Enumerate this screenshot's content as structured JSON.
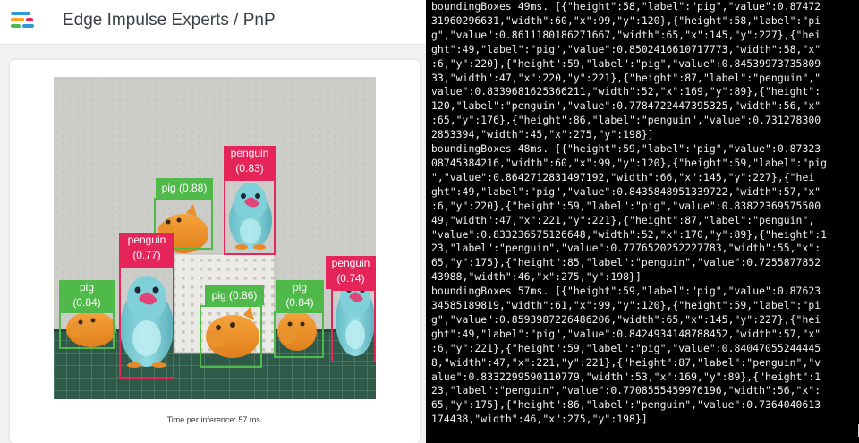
{
  "app": {
    "title": "Edge Impulse Experts / PnP"
  },
  "icons": {
    "logo": "edge-impulse-logo",
    "cursor": "terminal-cursor"
  },
  "colors": {
    "pig_box": "#4fb94a",
    "penguin_box": "#e5245a",
    "terminal_bg": "#000000",
    "terminal_text": "#f2f2f2"
  },
  "viewer": {
    "inference_text": "Time per inference: 57 ms."
  },
  "detections": [
    {
      "id": "penguin-top",
      "class": "penguin",
      "label": "penguin\n(0.83)"
    },
    {
      "id": "pig-back",
      "class": "pig",
      "label": "pig (0.88)"
    },
    {
      "id": "penguin-front",
      "class": "penguin",
      "label": "penguin\n(0.77)"
    },
    {
      "id": "penguin-right",
      "class": "penguin",
      "label": "penguin\n(0.74)"
    },
    {
      "id": "pig-left",
      "class": "pig",
      "label": "pig\n(0.84)"
    },
    {
      "id": "pig-middle",
      "class": "pig",
      "label": "pig (0.86)"
    },
    {
      "id": "pig-right",
      "class": "pig",
      "label": "pig\n(0.84)"
    }
  ],
  "terminal": {
    "text": "boundingBoxes 49ms. [{\"height\":58,\"label\":\"pig\",\"value\":0.87472\n31960296631,\"width\":60,\"x\":99,\"y\":120},{\"height\":58,\"label\":\"pi\ng\",\"value\":0.8611180186271667,\"width\":65,\"x\":145,\"y\":227},{\"hei\nght\":49,\"label\":\"pig\",\"value\":0.8502416610717773,\"width\":58,\"x\"\n:6,\"y\":220},{\"height\":59,\"label\":\"pig\",\"value\":0.84539973735809\n33,\"width\":47,\"x\":220,\"y\":221},{\"height\":87,\"label\":\"penguin\",\"\nvalue\":0.8339681625366211,\"width\":52,\"x\":169,\"y\":89},{\"height\":\n120,\"label\":\"penguin\",\"value\":0.7784722447395325,\"width\":56,\"x\"\n:65,\"y\":176},{\"height\":86,\"label\":\"penguin\",\"value\":0.731278300\n2853394,\"width\":45,\"x\":275,\"y\":198}]\nboundingBoxes 48ms. [{\"height\":59,\"label\":\"pig\",\"value\":0.87323\n08745384216,\"width\":60,\"x\":99,\"y\":120},{\"height\":59,\"label\":\"pig\n\",\"value\":0.8642712831497192,\"width\":66,\"x\":145,\"y\":227},{\"hei\nght\":49,\"label\":\"pig\",\"value\":0.8435848951339722,\"width\":57,\"x\"\n:6,\"y\":220},{\"height\":59,\"label\":\"pig\",\"value\":0.83822369575500\n49,\"width\":47,\"x\":221,\"y\":221},{\"height\":87,\"label\":\"penguin\",\n\"value\":0.833236575126648,\"width\":52,\"x\":170,\"y\":89},{\"height\":1\n23,\"label\":\"penguin\",\"value\":0.7776520252227783,\"width\":55,\"x\":\n65,\"y\":175},{\"height\":85,\"label\":\"penguin\",\"value\":0.7255877852\n43988,\"width\":46,\"x\":275,\"y\":198}]\nboundingBoxes 57ms. [{\"height\":59,\"label\":\"pig\",\"value\":0.87623\n34585189819,\"width\":61,\"x\":99,\"y\":120},{\"height\":59,\"label\":\"pi\ng\",\"value\":0.8593987226486206,\"width\":65,\"x\":145,\"y\":227},{\"hei\nght\":49,\"label\":\"pig\",\"value\":0.8424934148788452,\"width\":57,\"x\"\n:6,\"y\":221},{\"height\":59,\"label\":\"pig\",\"value\":0.84047055244445\n8,\"width\":47,\"x\":221,\"y\":221},{\"height\":87,\"label\":\"penguin\",\"v\nalue\":0.8332299590110779,\"width\":53,\"x\":169,\"y\":89},{\"height\":1\n23,\"label\":\"penguin\",\"value\":0.7708555459976196,\"width\":56,\"x\":\n65,\"y\":175},{\"height\":86,\"label\":\"penguin\",\"value\":0.7364040613\n174438,\"width\":46,\"x\":275,\"y\":198}]"
  }
}
